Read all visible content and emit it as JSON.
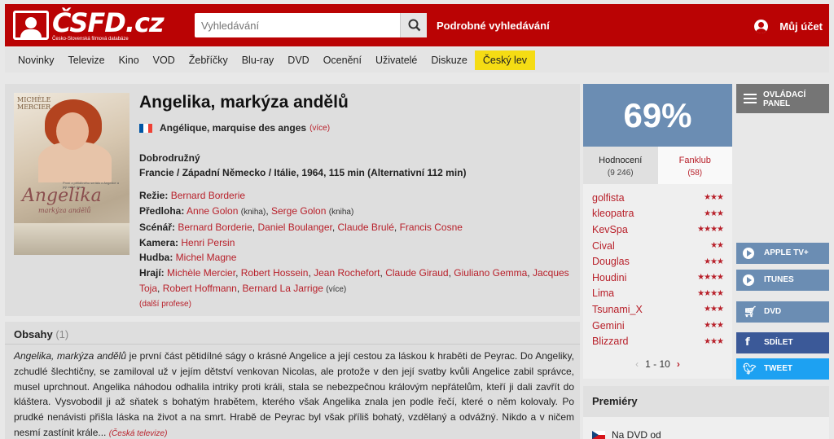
{
  "header": {
    "logo_text": "ČSFD.cz",
    "logo_subtitle": "Česko-Slovenská filmová databáze",
    "search_placeholder": "Vyhledávání",
    "advanced_search": "Podrobné vyhledávání",
    "account_label": "Můj účet"
  },
  "nav": [
    "Novinky",
    "Televize",
    "Kino",
    "VOD",
    "Žebříčky",
    "Blu-ray",
    "DVD",
    "Ocenění",
    "Uživatelé",
    "Diskuze",
    "Český lev"
  ],
  "film": {
    "title": "Angelika, markýza andělů",
    "original_title": "Angélique, marquise des anges",
    "original_more": "(více)",
    "genre": "Dobrodružný",
    "origin": "Francie / Západní Německo / Itálie, 1964, 115 min (Alternativní 112 min)",
    "poster": {
      "actor": "MICHÈLE MERCIER",
      "title": "Angelika",
      "subtitle": "markýza andělů",
      "tagline": "První z pětidílného seriálu o Angelice a její velké lásce"
    },
    "crew": {
      "director_label": "Režie:",
      "director": "Bernard Borderie",
      "source_label": "Předloha:",
      "source1": "Anne Golon",
      "source1_note": "(kniha)",
      "source2": "Serge Golon",
      "source2_note": "(kniha)",
      "writers_label": "Scénář:",
      "writers": [
        "Bernard Borderie",
        "Daniel Boulanger",
        "Claude Brulé",
        "Francis Cosne"
      ],
      "camera_label": "Kamera:",
      "camera": "Henri Persin",
      "music_label": "Hudba:",
      "music": "Michel Magne",
      "cast_label": "Hrají:",
      "cast": [
        "Michèle Mercier",
        "Robert Hossein",
        "Jean Rochefort",
        "Claude Giraud",
        "Giuliano Gemma",
        "Jacques Toja",
        "Robert Hoffmann",
        "Bernard La Jarrige"
      ],
      "cast_more": "(více)",
      "more_professions": "(další profese)"
    }
  },
  "plot": {
    "heading": "Obsahy",
    "count": "(1)",
    "title_italic": "Angelika, markýza andělů",
    "text": " je první část pětidílné ságy o krásné Angelice a její cestou za láskou k hraběti de Peyrac. Do Angeliky, zchudlé šlechtičny, se zamiloval už v jejím dětství venkovan Nicolas, ale protože v den její svatby kvůli Angelice zabil správce, musel uprchnout. Angelika náhodou odhalila intriky proti králi, stala se nebezpečnou královým nepřátelům, kteří ji dali zavřít do kláštera. Vysvobodil ji až sňatek s bohatým hrabětem, kterého však Angelika znala jen podle řečí, které o něm kolovaly. Po prudké nenávisti přišla láska na život a na smrt. Hrabě de Peyrac byl však příliš bohatý, vzdělaný a odvážný. Nikdo a v ničem nesmí zastínit krále...",
    "source": "(Česká televize)"
  },
  "rating": {
    "percent": "69%",
    "tab_ratings": "Hodnocení",
    "tab_ratings_count": "(9 246)",
    "tab_fanclub": "Fanklub",
    "tab_fanclub_count": "(58)",
    "raters": [
      {
        "name": "golfista",
        "stars": "★★★"
      },
      {
        "name": "kleopatra",
        "stars": "★★★"
      },
      {
        "name": "KevSpa",
        "stars": "★★★★"
      },
      {
        "name": "Cival",
        "stars": "★★"
      },
      {
        "name": "Douglas",
        "stars": "★★★"
      },
      {
        "name": "Houdini",
        "stars": "★★★★"
      },
      {
        "name": "Lima",
        "stars": "★★★★"
      },
      {
        "name": "Tsunami_X",
        "stars": "★★★"
      },
      {
        "name": "Gemini",
        "stars": "★★★"
      },
      {
        "name": "Blizzard",
        "stars": "★★★"
      }
    ],
    "pager": "1 - 10"
  },
  "premiery": {
    "heading": "Premiéry",
    "item": "Na DVD od"
  },
  "side": {
    "control_panel_line1": "OVLÁDACÍ",
    "control_panel_line2": "PANEL",
    "apple_tv": "APPLE TV+",
    "itunes": "ITUNES",
    "dvd": "DVD",
    "share": "SDÍLET",
    "tweet": "TWEET"
  },
  "colors": {
    "brand_red": "#ba0304",
    "rating_blue": "#6b8db3",
    "link_red": "#b8202a",
    "highlight_yellow": "#f5dc14",
    "facebook": "#3b5998",
    "twitter": "#1da1f2"
  }
}
